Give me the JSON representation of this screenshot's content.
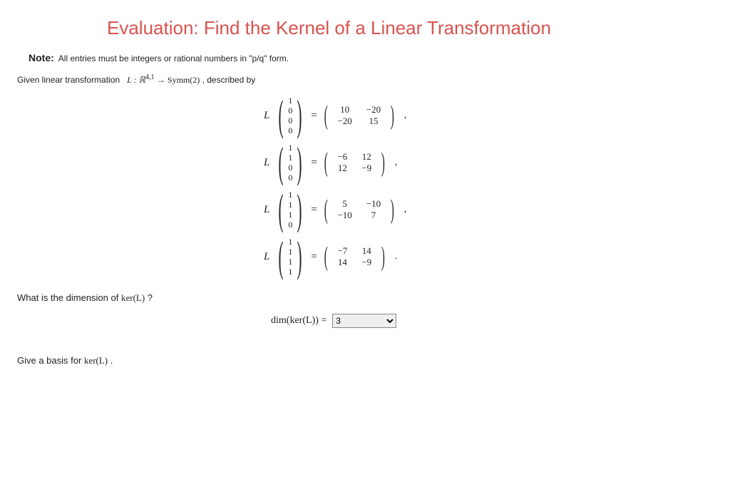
{
  "title": "Evaluation: Find the Kernel of a Linear Transformation",
  "note_label": "Note:",
  "note_text": "All entries must be integers or rational numbers in \"p/q\" form.",
  "given_prefix": "Given linear transformation ",
  "given_L": "L : ℝ",
  "given_exp": "4,1",
  "given_arrow": " → Symm(2)",
  "given_suffix": " , described by",
  "L_sym": "L",
  "eq_sym": "=",
  "eqs": [
    {
      "v": [
        "1",
        "0",
        "0",
        "0"
      ],
      "m": [
        [
          "10",
          "−20"
        ],
        [
          "−20",
          "15"
        ]
      ]
    },
    {
      "v": [
        "1",
        "1",
        "0",
        "0"
      ],
      "m": [
        [
          "−6",
          "12"
        ],
        [
          "12",
          "−9"
        ]
      ]
    },
    {
      "v": [
        "1",
        "1",
        "1",
        "0"
      ],
      "m": [
        [
          "5",
          "−10"
        ],
        [
          "−10",
          "7"
        ]
      ]
    },
    {
      "v": [
        "1",
        "1",
        "1",
        "1"
      ],
      "m": [
        [
          "−7",
          "14"
        ],
        [
          "14",
          "−9"
        ]
      ]
    }
  ],
  "q_dim_prefix": "What is the dimension of ",
  "q_dim_ker": "ker(L)",
  "q_dim_suffix": " ?",
  "dim_label": "dim(ker(L)) =",
  "dim_value": "3",
  "q_basis_prefix": "Give a basis for ",
  "q_basis_ker": "ker(L)",
  "q_basis_suffix": " ."
}
